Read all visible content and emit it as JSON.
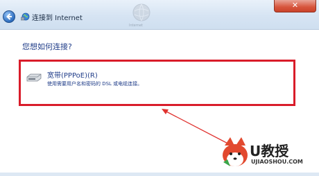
{
  "window": {
    "title": "连接到 Internet",
    "ghost_label": "Internet",
    "close_label": "✕"
  },
  "page": {
    "heading": "您想如何连接?"
  },
  "option": {
    "title": "宽带(PPPoE)(R)",
    "description": "使用需要用户名和密码的 DSL 或电缆连接。"
  },
  "watermark": {
    "brand": "U教授",
    "url": "UJIAOSHOU.COM"
  },
  "colors": {
    "highlight": "#d91c2a",
    "link_text": "#1f3c88"
  }
}
